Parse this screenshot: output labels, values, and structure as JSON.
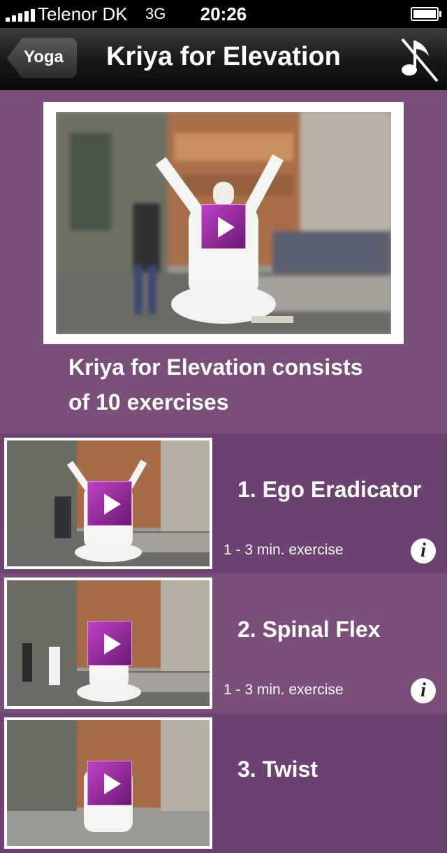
{
  "status_bar": {
    "carrier": "Telenor DK",
    "network": "3G",
    "time": "20:26"
  },
  "nav": {
    "back_label": "Yoga",
    "title": "Kriya for Elevation",
    "music_icon": "music-off-icon"
  },
  "hero": {
    "description": "Kriya for Elevation consists of 10 exercises"
  },
  "exercises": [
    {
      "title": "1. Ego Eradicator",
      "duration": "1 - 3 min. exercise"
    },
    {
      "title": "2. Spinal Flex",
      "duration": "1 - 3 min. exercise"
    },
    {
      "title": "3. Twist",
      "duration": ""
    }
  ],
  "colors": {
    "background": "#7a507b",
    "row_dark": "#6b4270",
    "play_button": "#9a2ea2"
  }
}
